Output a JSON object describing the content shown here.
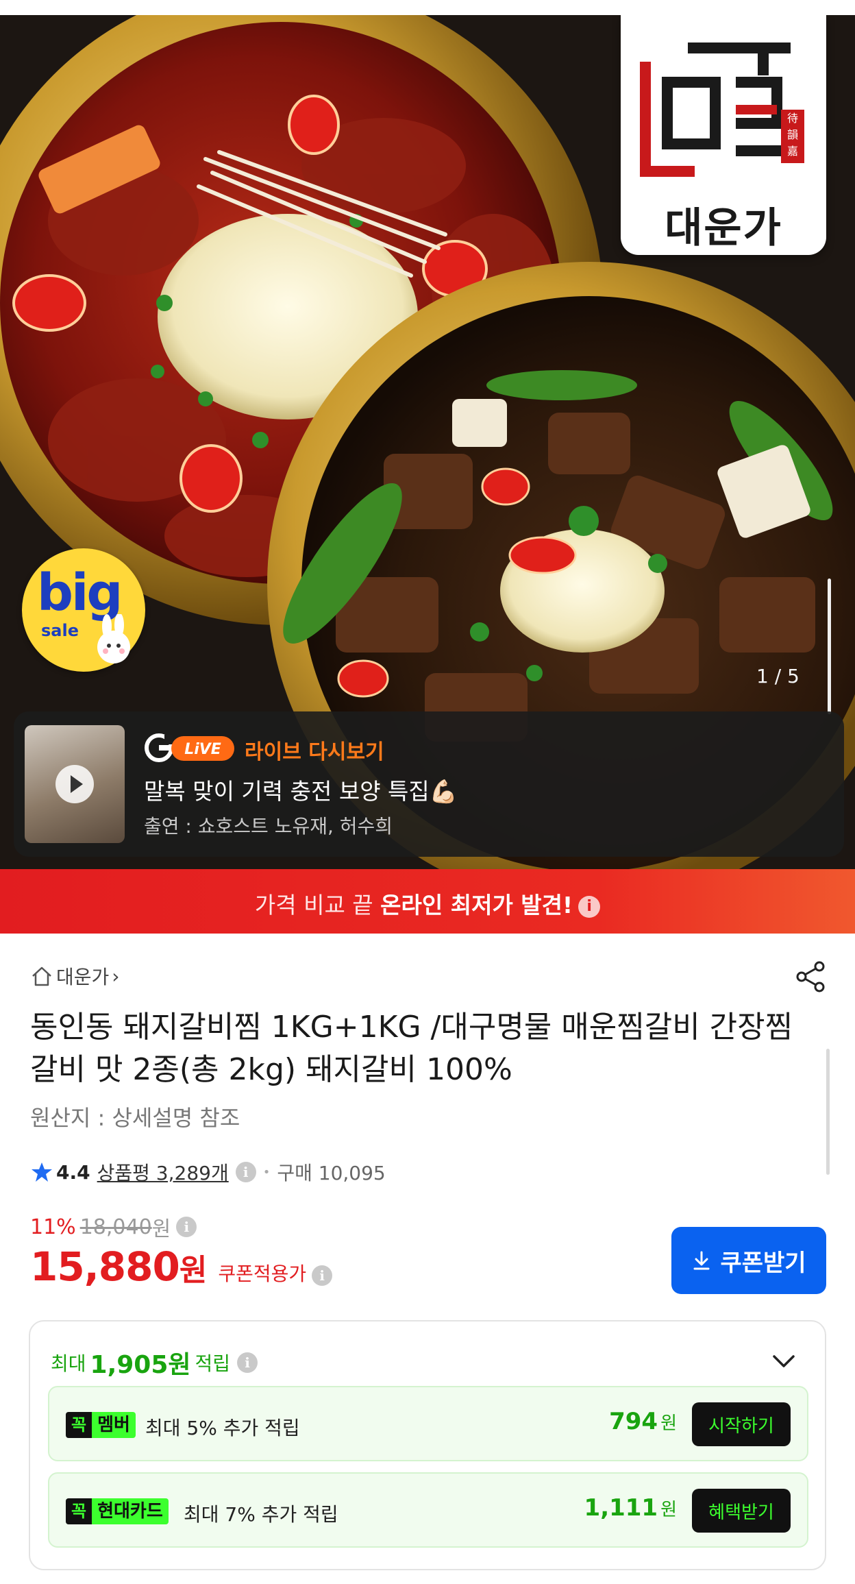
{
  "hero": {
    "logo_name": "대운가",
    "logo_seal": "待韻嘉",
    "big_sale": {
      "big": "big",
      "sale": "sale"
    },
    "indicator": "1 / 5"
  },
  "live": {
    "brand": "LiVE",
    "title": "라이브 다시보기",
    "main": "말복 맞이 기력 충전 보양 특집💪🏻",
    "sub": "출연 : 쇼호스트 노유재, 허수희"
  },
  "banner": {
    "prefix": "가격 비교 끝 ",
    "bold": "온라인 최저가 발견!",
    "info": "i"
  },
  "product": {
    "brand": "대운가",
    "brand_chevron": "›",
    "title": "동인동 돼지갈비찜 1KG+1KG /대구명물 매운찜갈비 간장찜갈비 맛 2종(총 2kg) 돼지갈비 100%",
    "origin": "원산지 : 상세설명 참조",
    "rating": "4.4",
    "reviews": "상품평 3,289개",
    "sep": "•",
    "purchases": "구매 10,095",
    "info": "i"
  },
  "price": {
    "discount": "11%",
    "original": "18,040",
    "original_unit": "원",
    "final": "15,880",
    "final_unit": "원",
    "coupon_label": "쿠폰적용가",
    "coupon_button": "쿠폰받기"
  },
  "points": {
    "prefix": "최대",
    "amount": "1,905원",
    "suffix": "적립",
    "items": [
      {
        "tag_k": "꼭",
        "tag_name": "멤버",
        "desc": "최대 5% 추가 적립",
        "value": "794",
        "unit": "원",
        "action": "시작하기"
      },
      {
        "tag_k": "꼭",
        "tag_name": "현대카드",
        "desc": "최대 7% 추가 적립",
        "value": "1,111",
        "unit": "원",
        "action": "혜택받기"
      }
    ]
  },
  "colors": {
    "accent_red": "#e21d20",
    "accent_blue": "#0a62f0",
    "accent_green": "#19a40f",
    "neon_green": "#3cff2e"
  }
}
